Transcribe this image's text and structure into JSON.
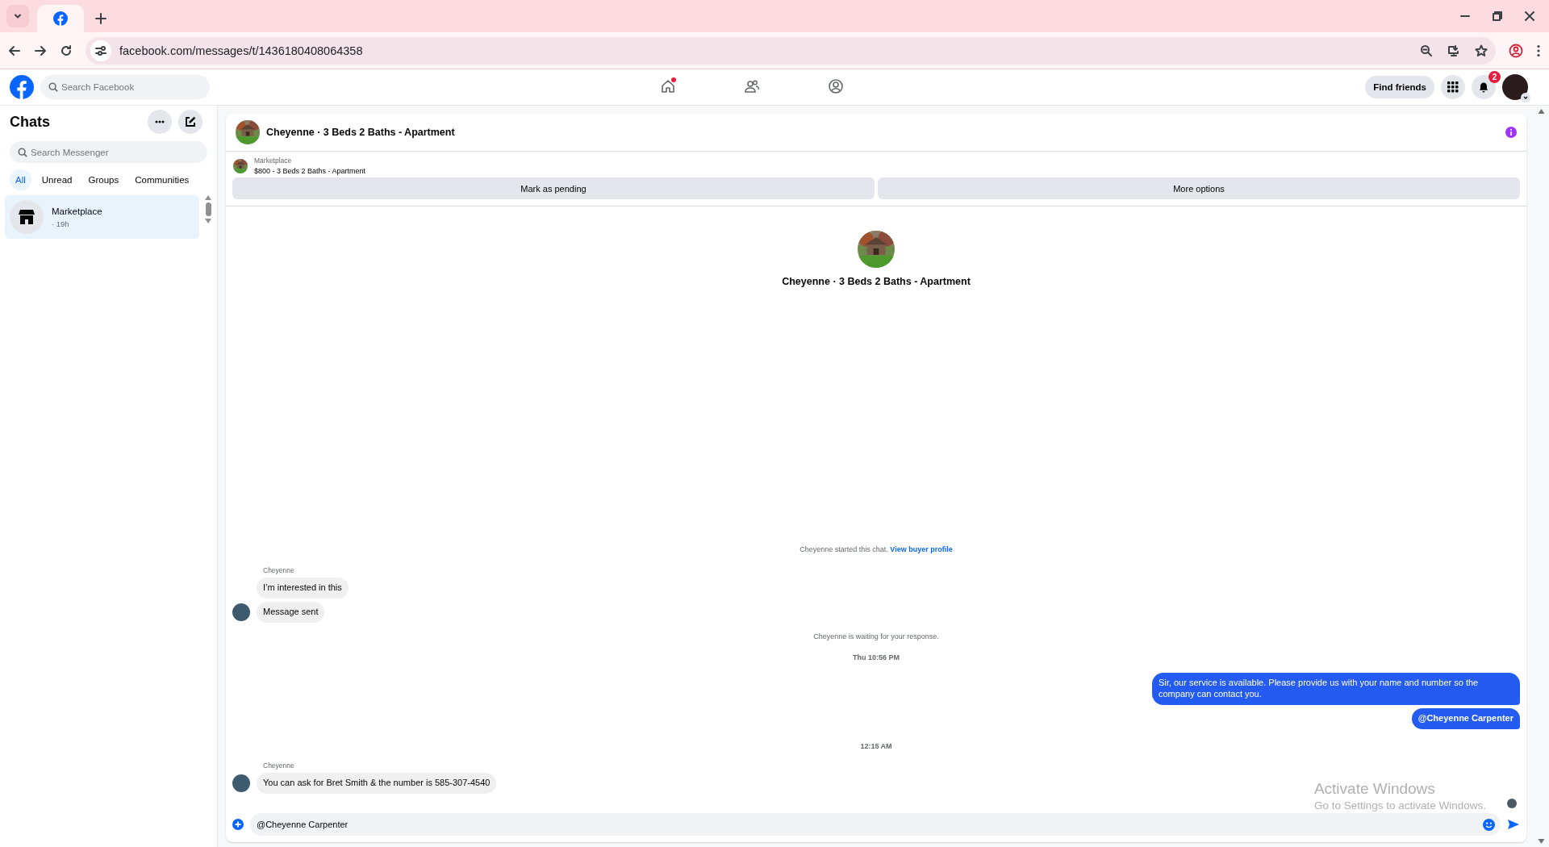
{
  "browser": {
    "tabs": [
      {
        "kind": "facebook",
        "selected": true
      }
    ],
    "url": "facebook.com/messages/t/1436180408064358"
  },
  "top_nav": {
    "search": {
      "placeholder": "Search Facebook"
    },
    "items": [
      {
        "kind": "home",
        "selected": false,
        "unread": true
      },
      {
        "kind": "friends",
        "selected": false,
        "unread": false
      },
      {
        "kind": "profile",
        "selected": false,
        "unread": false
      }
    ],
    "find_friends": "Find friends",
    "notification_count": "2"
  },
  "sidebar": {
    "title": "Chats",
    "search": {
      "placeholder": "Search Messenger"
    },
    "filters": [
      {
        "label": "All",
        "selected": true
      },
      {
        "label": "Unread",
        "selected": false
      },
      {
        "label": "Groups",
        "selected": false
      },
      {
        "label": "Communities",
        "selected": false
      }
    ],
    "chats": [
      {
        "name": "Marketplace",
        "time": "· 19h",
        "selected": true
      }
    ]
  },
  "chat": {
    "title": "Cheyenne · 3 Beds 2 Baths - Apartment",
    "listing": {
      "source": "Marketplace",
      "title": "$800 - 3 Beds 2 Baths - Apartment"
    },
    "actions": [
      "Mark as pending",
      "More options"
    ],
    "intro_title": "Cheyenne · 3 Beds 2 Baths - Apartment",
    "messages": [
      {
        "kind": "notice",
        "text": "Cheyenne started this chat.",
        "link": "View buyer profile"
      },
      {
        "kind": "incoming",
        "sender": "Cheyenne",
        "bubbles": [
          {
            "text": "I’m interested in this",
            "mention": false
          },
          {
            "text": "Message sent",
            "mention": false
          }
        ]
      },
      {
        "kind": "notice",
        "text": "Cheyenne is waiting for your response."
      },
      {
        "kind": "time",
        "text": "Thu 10:56 PM"
      },
      {
        "kind": "outgoing",
        "bubbles": [
          {
            "text": "Sir, our service is available. Please provide us with your name and number so the company can contact you.",
            "mention": false
          },
          {
            "text": "@Cheyenne Carpenter",
            "mention": true
          }
        ]
      },
      {
        "kind": "time",
        "text": "12:15 AM"
      },
      {
        "kind": "incoming",
        "sender": "Cheyenne",
        "bubbles": [
          {
            "text": "You can ask for Bret Smith & the number is 585-307-4540",
            "mention": false
          }
        ]
      }
    ],
    "composer": {
      "value": "@Cheyenne Carpenter"
    }
  },
  "os_notice": {
    "title": "Activate Windows",
    "subtitle": "Go to Settings to activate Windows."
  }
}
